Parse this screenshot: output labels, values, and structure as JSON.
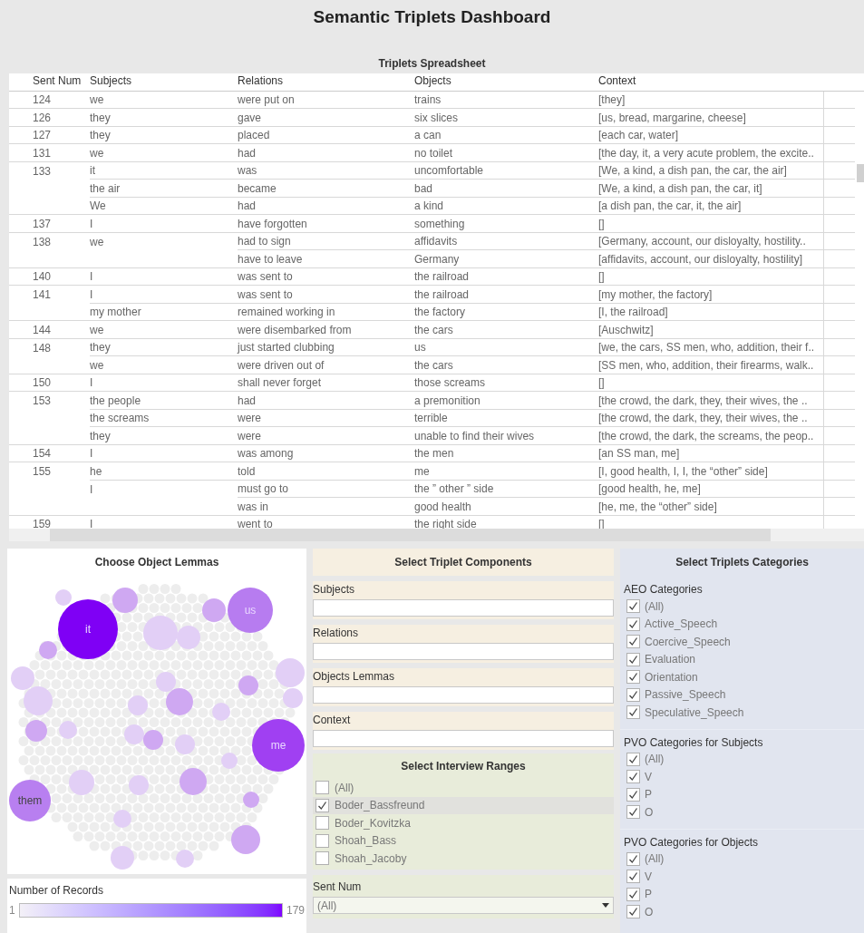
{
  "title": "Semantic Triplets Dashboard",
  "spreadsheet": {
    "title": "Triplets Spreadsheet",
    "columns": [
      "Sent Num",
      "Subjects",
      "Relations",
      "Objects",
      "Context"
    ],
    "rows": [
      {
        "sent": "124",
        "subject": "we",
        "relation": "were put on",
        "object": "trains",
        "context": "[they]"
      },
      {
        "sent": "126",
        "subject": "they",
        "relation": "gave",
        "object": "six slices",
        "context": "[us, bread, margarine, cheese]"
      },
      {
        "sent": "127",
        "subject": "they",
        "relation": "placed",
        "object": "a can",
        "context": "[each car, water]"
      },
      {
        "sent": "131",
        "subject": "we",
        "relation": "had",
        "object": "no toilet",
        "context": "[the day, it, a very acute problem, the excite.."
      },
      {
        "sent": "133",
        "subject": "it",
        "relation": "was",
        "object": "uncomfortable",
        "context": "[We, a kind, a dish pan, the car, the air]"
      },
      {
        "subject": "the air",
        "relation": "became",
        "object": "bad",
        "context": "[We, a kind, a dish pan, the car, it]"
      },
      {
        "subject": "We",
        "relation": "had",
        "object": "a kind",
        "context": "[a dish pan, the car, it, the air]"
      },
      {
        "sent": "137",
        "subject": "I",
        "relation": "have forgotten",
        "object": "something",
        "context": "[]"
      },
      {
        "sent": "138",
        "subject": "we",
        "relation": "had to sign",
        "object": "affidavits",
        "context": "[Germany, account, our disloyalty, hostility.."
      },
      {
        "relation": "have to leave",
        "object": "Germany",
        "context": "[affidavits, account, our disloyalty, hostility]"
      },
      {
        "sent": "140",
        "subject": "I",
        "relation": "was sent to",
        "object": "the railroad",
        "context": "[]"
      },
      {
        "sent": "141",
        "subject": "I",
        "relation": "was sent to",
        "object": "the railroad",
        "context": "[my mother, the factory]"
      },
      {
        "subject": "my mother",
        "relation": "remained working in",
        "object": "the factory",
        "context": "[I, the railroad]"
      },
      {
        "sent": "144",
        "subject": "we",
        "relation": "were disembarked from",
        "object": "the cars",
        "context": "[Auschwitz]"
      },
      {
        "sent": "148",
        "subject": "they",
        "relation": "just started clubbing",
        "object": "us",
        "context": "[we, the cars, SS men, who, addition, their f.."
      },
      {
        "subject": "we",
        "relation": "were driven out of",
        "object": "the cars",
        "context": "[SS men, who, addition, their firearms, walk.."
      },
      {
        "sent": "150",
        "subject": "I",
        "relation": "shall never forget",
        "object": "those screams",
        "context": "[]"
      },
      {
        "sent": "153",
        "subject": "the people",
        "relation": "had",
        "object": "a premonition",
        "context": "[the crowd, the dark, they, their wives, the .."
      },
      {
        "subject": "the screams",
        "relation": "were",
        "object": "terrible",
        "context": "[the crowd, the dark, they, their wives, the .."
      },
      {
        "subject": "they",
        "relation": "were",
        "object": "unable to find their wives",
        "context": "[the crowd, the dark, the screams, the peop.."
      },
      {
        "sent": "154",
        "subject": "I",
        "relation": "was among",
        "object": "the men",
        "context": "[an SS man, me]"
      },
      {
        "sent": "155",
        "subject": "he",
        "relation": "told",
        "object": "me",
        "context": "[I, good health, I, I, the “other” side]"
      },
      {
        "subject": "I",
        "relation": "must go to",
        "object": "the ” other ” side",
        "context": "[good health, he, me]"
      },
      {
        "relation": "was in",
        "object": "good health",
        "context": "[he, me, the “other” side]"
      },
      {
        "sent": "159",
        "subject": "I",
        "relation": "went to",
        "object": "the right side",
        "context": "[]"
      }
    ]
  },
  "object_lemmas": {
    "title": "Choose Object Lemmas",
    "bubbles": [
      {
        "label": "it",
        "color": "#7f00f5"
      },
      {
        "label": "us",
        "color": "#b77cf0"
      },
      {
        "label": "me",
        "color": "#a040f2"
      },
      {
        "label": "them",
        "color": "#b87ff0"
      }
    ]
  },
  "legend": {
    "title": "Number of Records",
    "min": "1",
    "max": "179"
  },
  "components": {
    "title": "Select Triplet Components",
    "fields": [
      {
        "label": "Subjects"
      },
      {
        "label": "Relations"
      },
      {
        "label": "Objects Lemmas"
      },
      {
        "label": "Context"
      }
    ]
  },
  "interview_ranges": {
    "title": "Select Interview Ranges",
    "items": [
      {
        "label": "(All)",
        "checked": false
      },
      {
        "label": "Boder_Bassfreund",
        "checked": true
      },
      {
        "label": "Boder_Kovitzka",
        "checked": false
      },
      {
        "label": "Shoah_Bass",
        "checked": false
      },
      {
        "label": "Shoah_Jacoby",
        "checked": false
      }
    ]
  },
  "sent_num": {
    "label": "Sent Num",
    "value": "(All)"
  },
  "categories": {
    "title": "Select Triplets Categories",
    "groups": [
      {
        "title": "AEO Categories",
        "items": [
          {
            "label": "(All)",
            "checked": true
          },
          {
            "label": "Active_Speech",
            "checked": true
          },
          {
            "label": "Coercive_Speech",
            "checked": true
          },
          {
            "label": "Evaluation",
            "checked": true
          },
          {
            "label": "Orientation",
            "checked": true
          },
          {
            "label": "Passive_Speech",
            "checked": true
          },
          {
            "label": "Speculative_Speech",
            "checked": true
          }
        ]
      },
      {
        "title": "PVO Categories for Subjects",
        "items": [
          {
            "label": "(All)",
            "checked": true
          },
          {
            "label": "V",
            "checked": true
          },
          {
            "label": "P",
            "checked": true
          },
          {
            "label": "O",
            "checked": true
          }
        ]
      },
      {
        "title": "PVO Categories for Objects",
        "items": [
          {
            "label": "(All)",
            "checked": true
          },
          {
            "label": "V",
            "checked": true
          },
          {
            "label": "P",
            "checked": true
          },
          {
            "label": "O",
            "checked": true
          }
        ]
      }
    ]
  }
}
